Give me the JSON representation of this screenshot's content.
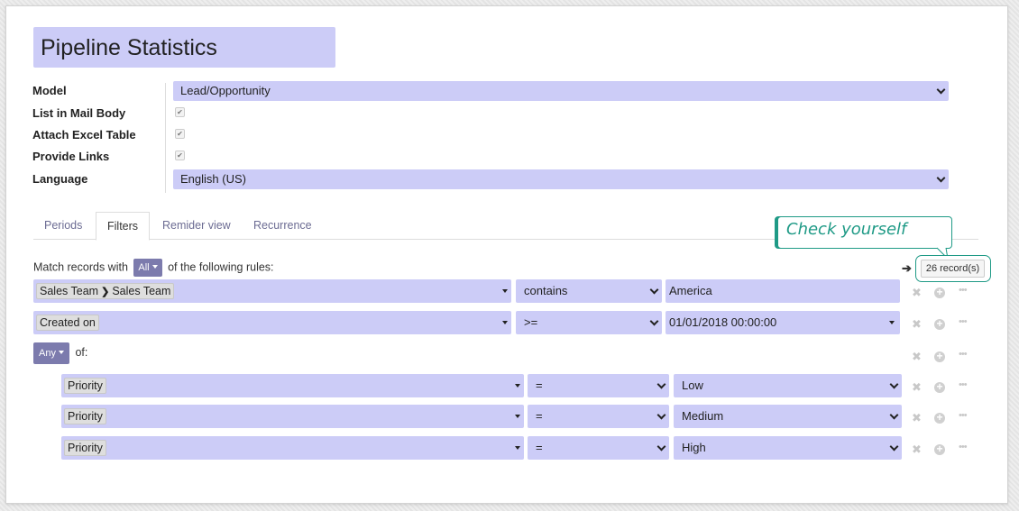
{
  "form": {
    "title": "Pipeline Statistics",
    "model_label": "Model",
    "model_value": "Lead/Opportunity",
    "list_in_mail_body_label": "List in Mail Body",
    "attach_excel_table_label": "Attach Excel Table",
    "provide_links_label": "Provide Links",
    "language_label": "Language",
    "language_value": "English (US)",
    "check_glyph": "✔"
  },
  "tabs": [
    "Periods",
    "Filters",
    "Remider view",
    "Recurrence"
  ],
  "active_tab": "Filters",
  "filters": {
    "match_prefix": "Match records with",
    "match_mode": "All",
    "match_suffix": "of the following rules:",
    "records_count": "26 record(s)",
    "arrow_glyph": "➔",
    "rules": [
      {
        "field": [
          "Sales Team",
          "Sales Team"
        ],
        "separator": "❯",
        "operator": "contains",
        "value": "America"
      },
      {
        "field": [
          "Created on"
        ],
        "operator": ">=",
        "value": "01/01/2018 00:00:00"
      }
    ],
    "group": {
      "mode": "Any",
      "suffix": "of:",
      "rules": [
        {
          "field": "Priority",
          "operator": "=",
          "value": "Low"
        },
        {
          "field": "Priority",
          "operator": "=",
          "value": "Medium"
        },
        {
          "field": "Priority",
          "operator": "=",
          "value": "High"
        }
      ]
    },
    "icons": {
      "delete": "✖",
      "add": "+",
      "more": "•••"
    }
  },
  "callout": {
    "text": "Check yourself"
  },
  "colors": {
    "highlight": "#ccccf7",
    "accent": "#7c7bad",
    "callout": "#1f9a86"
  },
  "icon_names": [
    "chevron-down-icon",
    "caret-down-icon",
    "check-icon",
    "close-icon",
    "add-circle-icon",
    "ellipsis-icon",
    "arrow-right-icon"
  ]
}
